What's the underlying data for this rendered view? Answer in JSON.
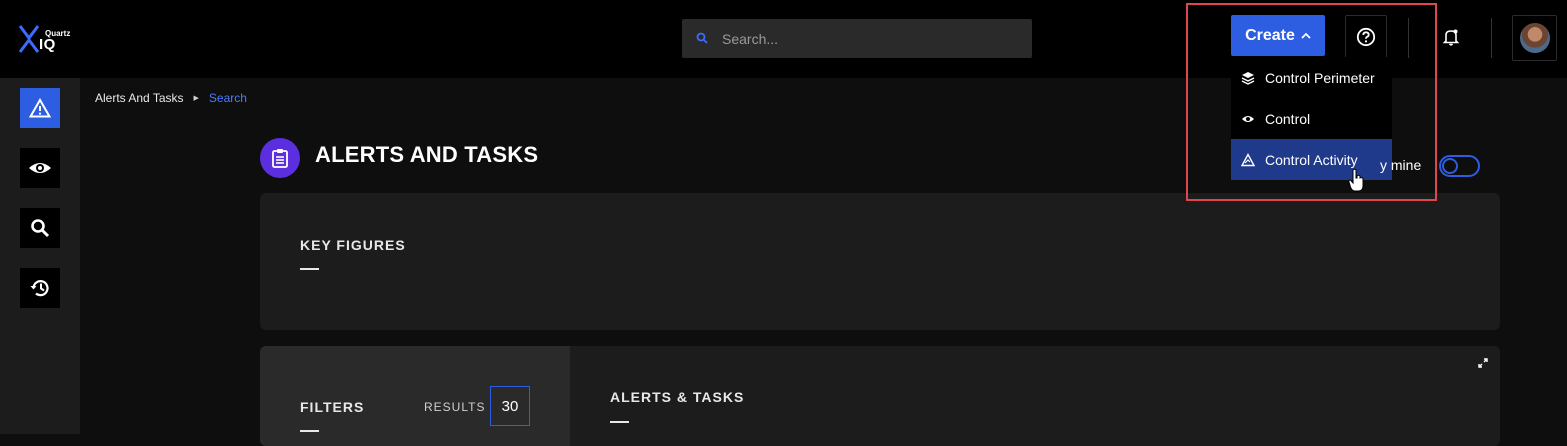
{
  "header": {
    "logo": {
      "brand_top": "Quartz",
      "brand_main": "IQ"
    },
    "search": {
      "placeholder": "Search..."
    },
    "create_label": "Create",
    "icons": [
      "help-circle-icon",
      "bell-icon",
      "user-avatar"
    ]
  },
  "create_menu": {
    "items": [
      {
        "label": "Control Perimeter",
        "icon": "layers-icon",
        "active": false
      },
      {
        "label": "Control",
        "icon": "eye-icon",
        "active": false
      },
      {
        "label": "Control Activity",
        "icon": "activity-triangle-icon",
        "active": true
      }
    ]
  },
  "sidebar": {
    "items": [
      {
        "icon": "warning-triangle-icon",
        "active": true
      },
      {
        "icon": "eye-icon",
        "active": false
      },
      {
        "icon": "search-icon",
        "active": false
      },
      {
        "icon": "history-icon",
        "active": false
      }
    ]
  },
  "breadcrumb": {
    "items": [
      "Alerts And Tasks",
      "Search"
    ]
  },
  "page": {
    "title": "ALERTS AND TASKS",
    "only_mine_label": "y mine",
    "only_mine_enabled": false
  },
  "key_figures": {
    "title": "KEY FIGURES"
  },
  "filters": {
    "title": "FILTERS",
    "results_label": "RESULTS",
    "results_count": "30"
  },
  "alerts_tasks": {
    "title": "ALERTS & TASKS"
  },
  "colors": {
    "accent": "#2d5de0",
    "active_menu": "#1f3a8a",
    "page_icon": "#5b2ee0",
    "highlight": "#e0474c"
  }
}
